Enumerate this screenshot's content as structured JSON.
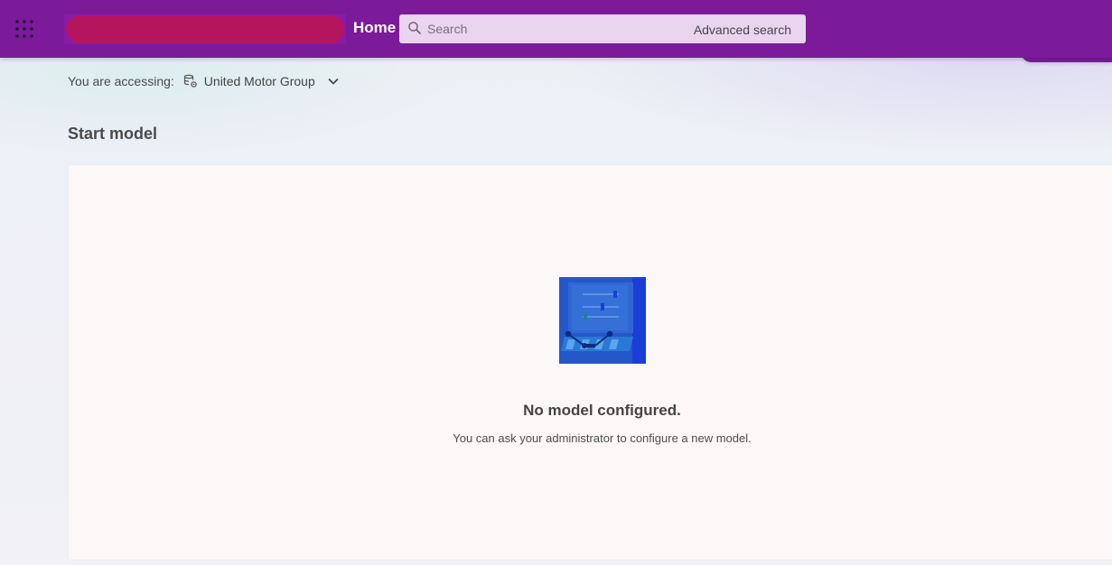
{
  "header": {
    "home_label": "Home",
    "search": {
      "placeholder": "Search",
      "advanced_label": "Advanced search"
    },
    "colors": {
      "bar": "#7b1b9a",
      "logo_redaction": "#b5155e",
      "search_bg": "#ead5ee"
    },
    "icons": {
      "app_launcher": "grid-dots-icon",
      "search": "search-icon"
    }
  },
  "context": {
    "label": "You are accessing:",
    "organization": "United Motor Group",
    "icons": {
      "organization": "database-settings-icon",
      "expand": "chevron-down-icon"
    }
  },
  "page": {
    "title": "Start model"
  },
  "empty_state": {
    "title": "No model configured.",
    "description": "You can ask your administrator to configure a new model.",
    "illustration": "model-configuration-illustration"
  }
}
